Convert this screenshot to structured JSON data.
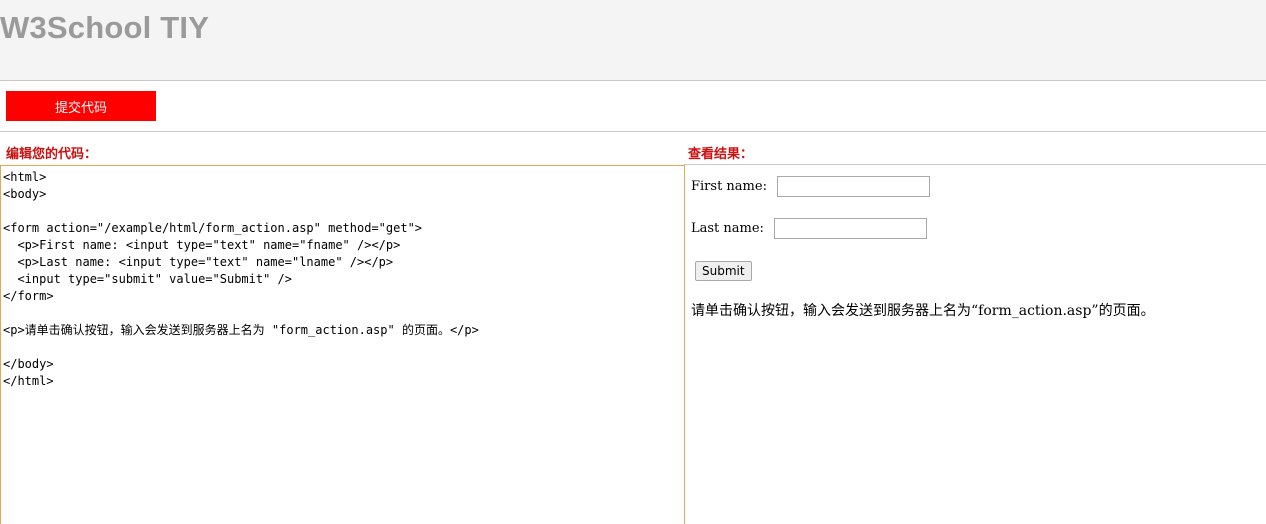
{
  "header": {
    "title": "W3School TIY"
  },
  "toolbar": {
    "submit_label": "提交代码"
  },
  "editor": {
    "heading": "编辑您的代码：",
    "code": "<html>\n<body>\n\n<form action=\"/example/html/form_action.asp\" method=\"get\">\n  <p>First name: <input type=\"text\" name=\"fname\" /></p>\n  <p>Last name: <input type=\"text\" name=\"lname\" /></p>\n  <input type=\"submit\" value=\"Submit\" />\n</form>\n\n<p>请单击确认按钮，输入会发送到服务器上名为 \"form_action.asp\" 的页面。</p>\n\n</body>\n</html>"
  },
  "result": {
    "heading": "查看结果：",
    "first_name_label": "First name:",
    "first_name_value": "",
    "last_name_label": "Last name:",
    "last_name_value": "",
    "submit_label": "Submit",
    "paragraph": "请单击确认按钮，输入会发送到服务器上名为“form_action.asp”的页面。"
  },
  "colors": {
    "submit_button_bg": "#ff0000",
    "heading_text": "#cc1111",
    "editor_border": "#e2a955",
    "title_text": "#9a9a9a"
  }
}
